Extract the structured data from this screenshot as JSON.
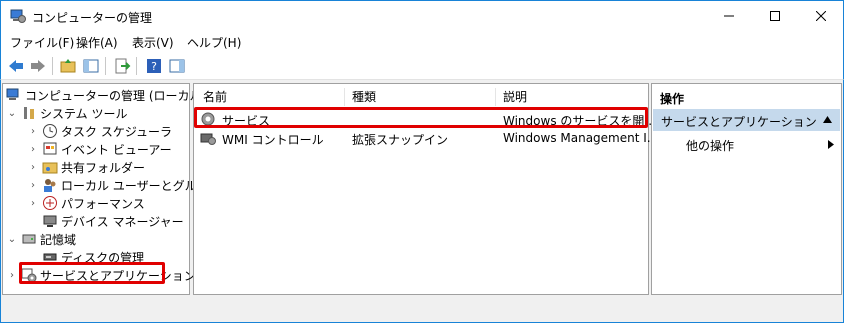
{
  "window": {
    "title": "コンピューターの管理"
  },
  "menu": [
    "ファイル(F)",
    "操作(A)",
    "表示(V)",
    "ヘルプ(H)"
  ],
  "tree": {
    "root": "コンピューターの管理 (ローカル)",
    "system_tools": "システム ツール",
    "task_scheduler": "タスク スケジューラ",
    "event_viewer": "イベント ビューアー",
    "shared_folders": "共有フォルダー",
    "local_users": "ローカル ユーザーとグループ",
    "performance": "パフォーマンス",
    "device_manager": "デバイス マネージャー",
    "storage": "記憶域",
    "disk_management": "ディスクの管理",
    "services_apps": "サービスとアプリケーション"
  },
  "list": {
    "columns": [
      "名前",
      "種類",
      "説明"
    ],
    "rows": [
      {
        "name": "サービス",
        "type": "",
        "desc": "Windows のサービスを開..."
      },
      {
        "name": "WMI コントロール",
        "type": "拡張スナップイン",
        "desc": "Windows Management I..."
      }
    ]
  },
  "actions": {
    "title": "操作",
    "group": "サービスとアプリケーション",
    "other": "他の操作"
  },
  "colors": {
    "highlight": "#e00000",
    "selected_group": "#c5d9ec",
    "accent": "#1883d7"
  }
}
